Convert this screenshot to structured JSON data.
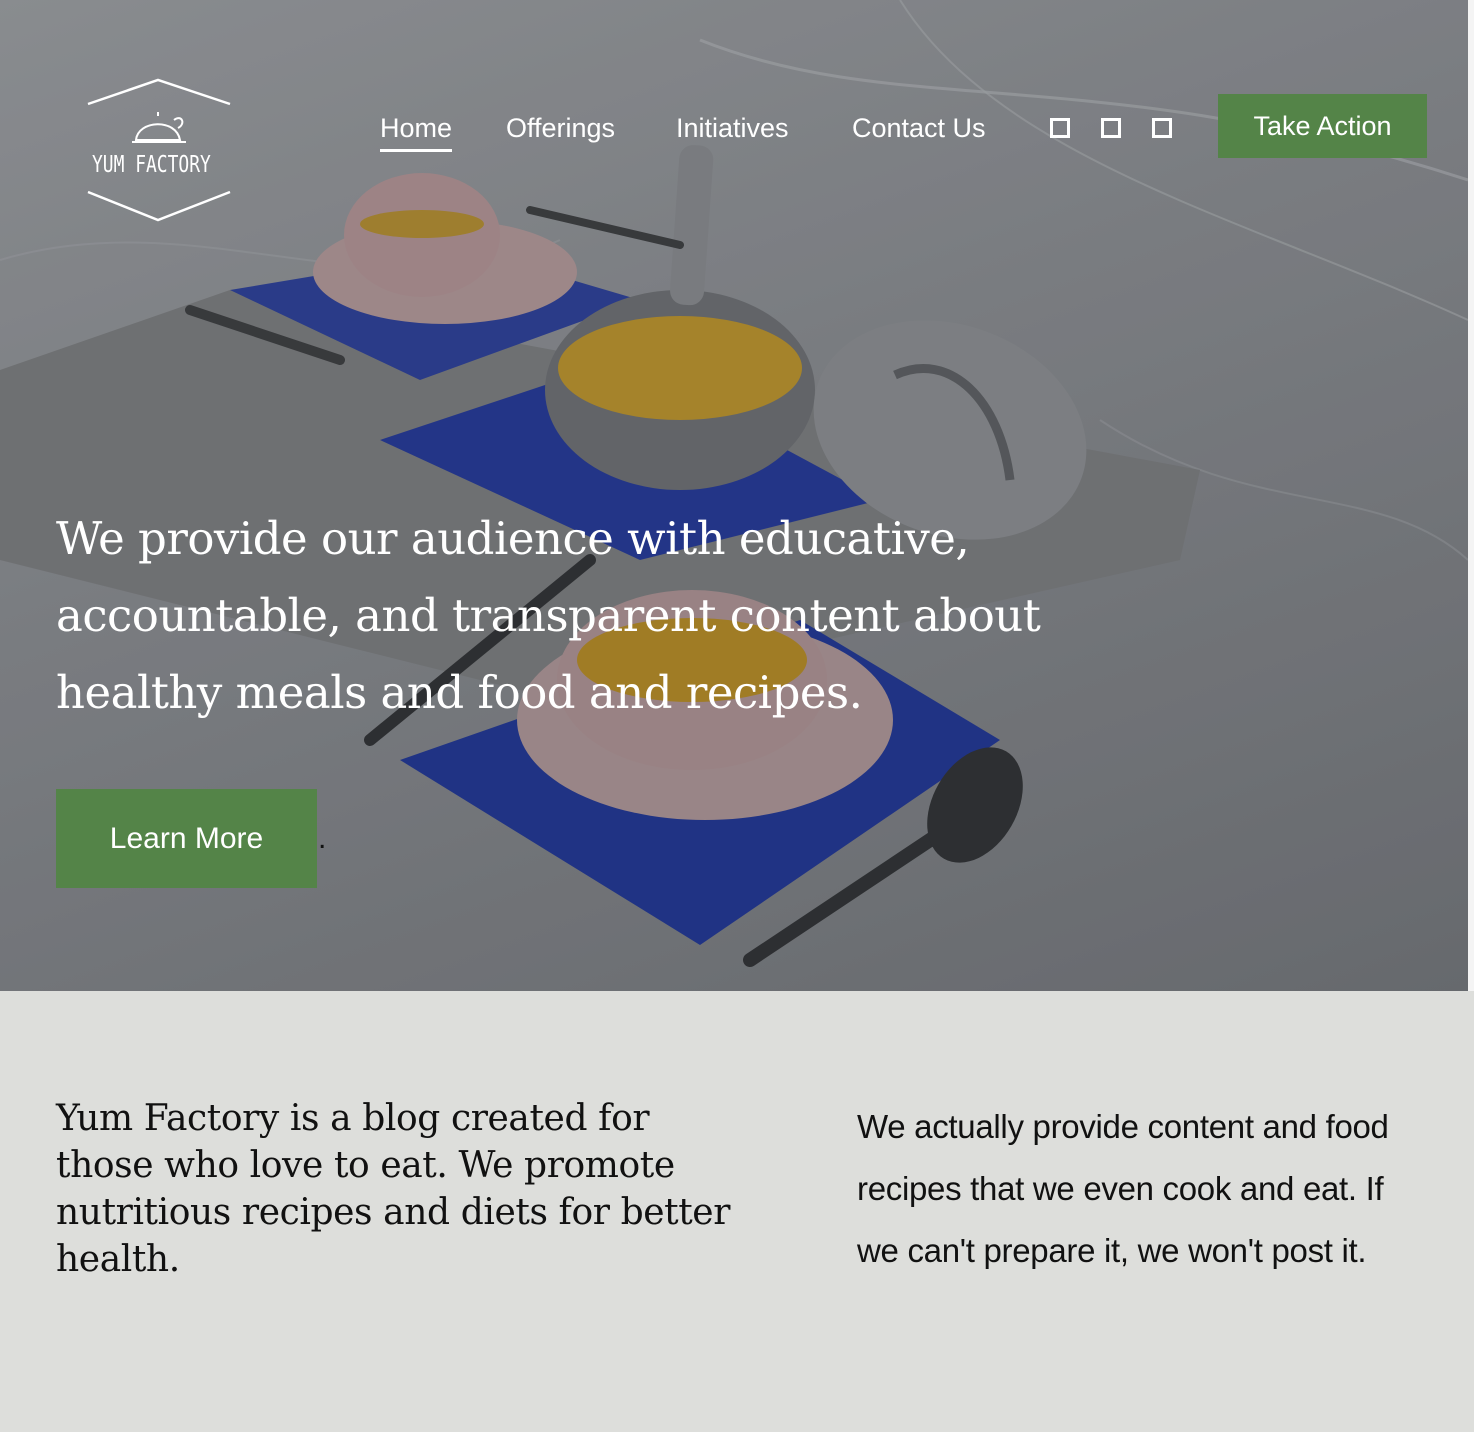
{
  "brand": {
    "name": "YUM FACTORY",
    "accent_color": "#548448"
  },
  "nav": {
    "items": [
      {
        "label": "Home",
        "active": true
      },
      {
        "label": "Offerings",
        "active": false
      },
      {
        "label": "Initiatives",
        "active": false
      },
      {
        "label": "Contact Us",
        "active": false
      }
    ],
    "social_icons": [
      "square-icon",
      "square-icon",
      "square-icon"
    ],
    "cta_label": "Take Action"
  },
  "hero": {
    "headline": "We provide our audience with educative, accountable, and transparent content about healthy meals and food and recipes.",
    "button_label": "Learn More",
    "trailing_text": "."
  },
  "about": {
    "left_text": "Yum Factory is a blog created for those who love to eat. We promote nutritious recipes and diets for better health.",
    "right_text": "We actually provide content and food recipes that we even cook and eat. If we can't prepare it, we won't post it."
  }
}
